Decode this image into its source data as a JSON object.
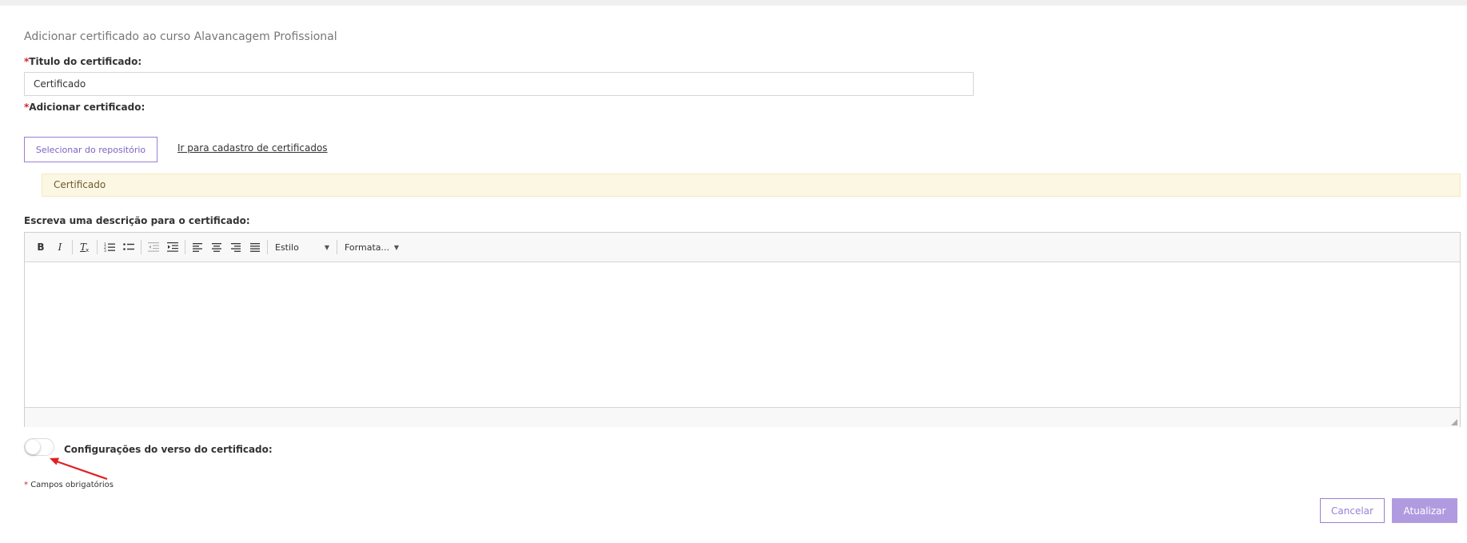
{
  "page": {
    "title": "Adicionar certificado ao curso Alavancagem Profissional"
  },
  "form": {
    "required_mark": "*",
    "title_label": "Titulo do certificado:",
    "title_value": "Certificado",
    "add_cert_label": "Adicionar certificado:",
    "select_repo_button": "Selecionar do repositório",
    "register_link": "Ir para cadastro de certificados",
    "selected_certificate": "Certificado",
    "description_label": "Escreva uma descrição para o certificado:",
    "description_value": ""
  },
  "editor": {
    "toolbar": {
      "bold": "B",
      "italic": "I",
      "remove_format": "Tx",
      "style_combo": "Estilo",
      "format_combo": "Formata..."
    }
  },
  "toggle": {
    "label": "Configurações do verso do certificado:",
    "checked": false
  },
  "footer": {
    "required_mark": "*",
    "required_note": "Campos obrigatórios",
    "cancel_button": "Cancelar",
    "update_button": "Atualizar"
  },
  "colors": {
    "accent": "#9b7fd4",
    "primary_button": "#b19be0",
    "required": "#d9232d",
    "notice_bg": "#fcf7e3",
    "annotation_arrow": "#e02020"
  },
  "icons": [
    "bold-icon",
    "italic-icon",
    "remove-format-icon",
    "numbered-list-icon",
    "bulleted-list-icon",
    "decrease-indent-icon",
    "increase-indent-icon",
    "align-left-icon",
    "align-center-icon",
    "align-right-icon",
    "align-justify-icon",
    "resize-grip-icon",
    "annotation-arrow-icon"
  ]
}
